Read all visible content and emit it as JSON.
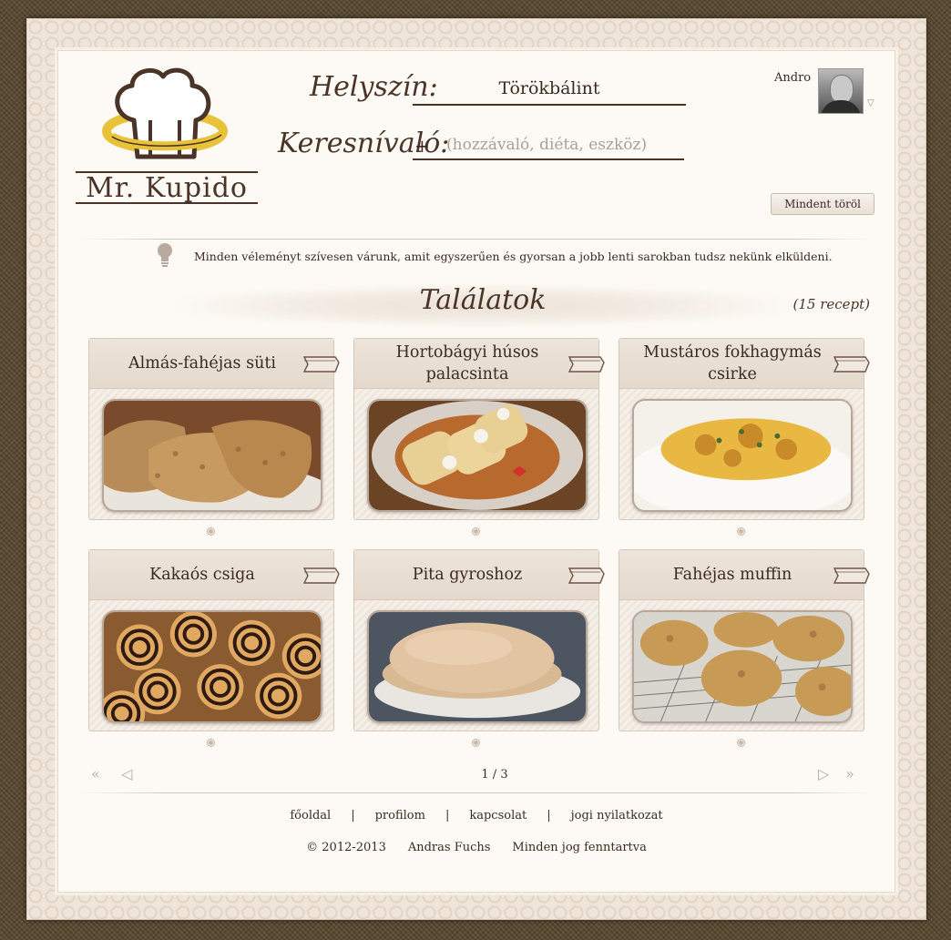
{
  "brand": {
    "name": "Mr. Kupido"
  },
  "search": {
    "location_label": "Helyszín:",
    "location_value": "Törökbálint",
    "query_label": "Keresnívaló:",
    "query_prefix": "+",
    "query_placeholder": "(hozzávaló, diéta, eszköz)"
  },
  "user": {
    "name": "Andro",
    "menu_icon": "triangle-down-icon"
  },
  "actions": {
    "clear_all_label": "Mindent töröl"
  },
  "notice": {
    "icon": "lightbulb-icon",
    "text": "Minden véleményt szívesen várunk, amit egyszerűen és gyorsan a jobb lenti sarokban tudsz nekünk elküldeni."
  },
  "results": {
    "title": "Találatok",
    "count": "(15 recept)"
  },
  "recipes": [
    {
      "title": "Almás-fahéjas süti",
      "image": "oat-cookies"
    },
    {
      "title": "Hortobágyi húsos palacsinta",
      "image": "stuffed-crepes"
    },
    {
      "title": "Mustáros fokhagymás csirke",
      "image": "chicken-rice"
    },
    {
      "title": "Kakaós csiga",
      "image": "cocoa-rolls"
    },
    {
      "title": "Pita gyroshoz",
      "image": "pita-bread"
    },
    {
      "title": "Fahéjas muffin",
      "image": "cinnamon-muffins"
    }
  ],
  "pagination": {
    "text": "1 / 3",
    "first_icon": "double-left-icon",
    "prev_icon": "left-icon",
    "next_icon": "right-icon",
    "last_icon": "double-right-icon"
  },
  "footer": {
    "links": [
      "főoldal",
      "profilom",
      "kapcsolat",
      "jogi nyilatkozat"
    ],
    "separator": "|",
    "copyright": "© 2012-2013",
    "author": "Andras Fuchs",
    "rights": "Minden jog fenntartva"
  },
  "colors": {
    "brand_brown": "#4a3427",
    "accent_yellow": "#e8c33a",
    "paper": "#fdfaf5"
  }
}
